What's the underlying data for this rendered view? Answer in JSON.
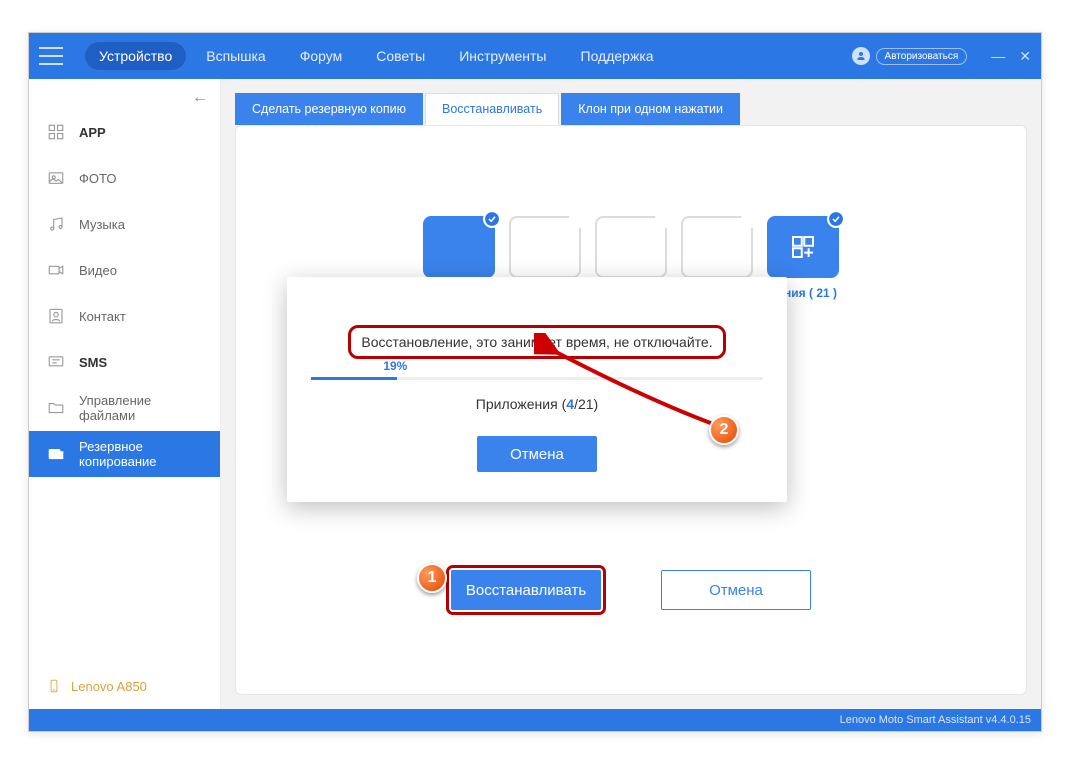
{
  "nav": {
    "items": [
      "Устройство",
      "Вспышка",
      "Форум",
      "Советы",
      "Инструменты",
      "Поддержка"
    ],
    "active_index": 0,
    "login": "Авторизоваться"
  },
  "sidebar": {
    "items": [
      {
        "label": "APP",
        "bold": true
      },
      {
        "label": "ФОТО"
      },
      {
        "label": "Музыка"
      },
      {
        "label": "Видео"
      },
      {
        "label": "Контакт"
      },
      {
        "label": "SMS",
        "bold": true
      },
      {
        "label": "Управление файлами"
      },
      {
        "label": "Резервное копирование",
        "active": true
      }
    ],
    "device": "Lenovo A850"
  },
  "tabs": {
    "items": [
      "Сделать резервную копию",
      "Восстанавливать",
      "Клон при одном нажатии"
    ],
    "active_index": 1
  },
  "categories": {
    "last_label": "жения",
    "last_count": "( 21 )"
  },
  "actions": {
    "primary": "Восстанавливать",
    "secondary": "Отмена"
  },
  "modal": {
    "message": "Восстановление, это занимает время, не отключайте.",
    "percent": "19%",
    "item_label": "Приложения",
    "current": "4",
    "total": "21",
    "cancel": "Отмена"
  },
  "statusbar": "Lenovo Moto Smart Assistant v4.4.0.15",
  "callouts": {
    "one": "1",
    "two": "2"
  }
}
